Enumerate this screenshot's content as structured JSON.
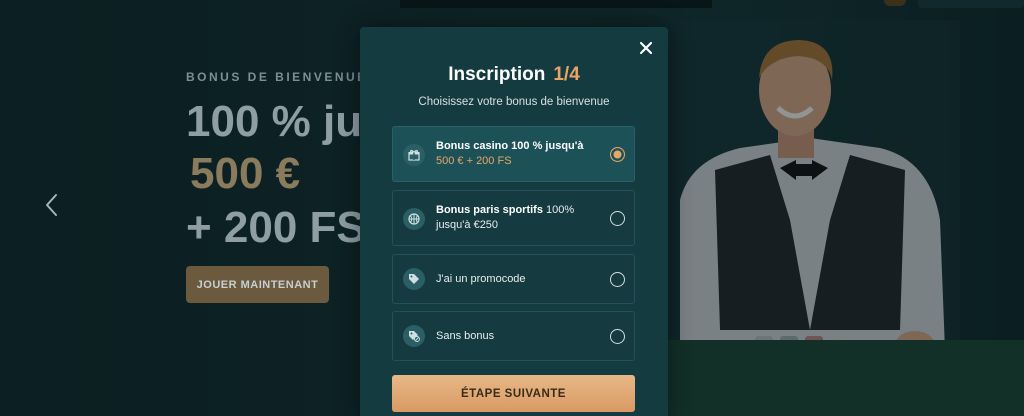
{
  "background": {
    "hero": {
      "kicker": "BONUS DE BIENVENUE",
      "line1": "100 % jusqu'à",
      "line2": "500 €",
      "line3": "+ 200 FS",
      "cta_label": "JOUER MAINTENANT"
    },
    "carousel_prev_icon": "chevron-left-icon"
  },
  "modal": {
    "title": "Inscription",
    "step": "1/4",
    "subtitle": "Choisissez votre bonus de bienvenue",
    "close_icon": "close-icon",
    "options": [
      {
        "icon": "gift-icon",
        "title": "Bonus casino 100 % jusqu'à",
        "detail": "500 € + 200 FS",
        "selected": true
      },
      {
        "icon": "basketball-icon",
        "title": "Bonus paris sportifs",
        "title_suffix": " 100%",
        "detail": "jusqu'à €250",
        "selected": false
      },
      {
        "icon": "tag-icon",
        "title": "J'ai un promocode",
        "selected": false
      },
      {
        "icon": "no-bonus-tag-icon",
        "title": "Sans bonus",
        "selected": false
      }
    ],
    "next_label": "ÉTAPE SUIVANTE"
  },
  "colors": {
    "accent": "#e9a566",
    "modal_bg": "#143b40",
    "selected_option_bg": "#1d5158",
    "button_gradient_top": "#e7b888",
    "button_gradient_bottom": "#d99a63"
  }
}
